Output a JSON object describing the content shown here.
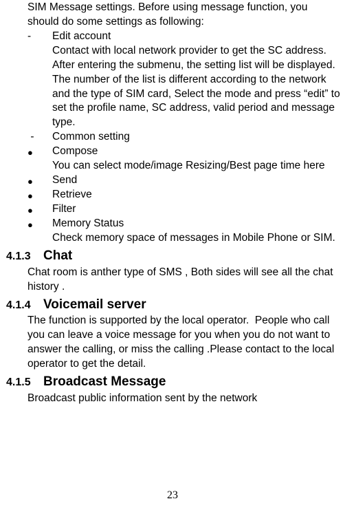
{
  "intro1": "SIM Message settings. Before using message function, you should do some settings as following:",
  "dash": "-",
  "bullet": "●",
  "editAccount": {
    "title": "Edit account",
    "desc": "Contact with local network provider to get the SC address. After entering the submenu, the setting list will be displayed. The number of the list is different according to the network and the type of SIM card, Select the mode and press “edit” to set the profile name, SC address, valid period and message type."
  },
  "commonSetting": "Common setting",
  "compose": {
    "title": "Compose",
    "desc": "You can select mode/image Resizing/Best page time here"
  },
  "send": "Send",
  "retrieve": "Retrieve",
  "filter": "Filter",
  "memoryStatus": {
    "title": "Memory Status",
    "desc": "Check memory space of messages in Mobile Phone or SIM."
  },
  "sec413": {
    "num": "4.1.3",
    "title": "Chat",
    "body": "Chat room is anther type of SMS , Both sides will see all the chat history ."
  },
  "sec414": {
    "num": "4.1.4",
    "title": "Voicemail server",
    "body": "The function is supported by the local operator.  People who call you can leave a voice message for you when you do not want to answer the calling, or miss the calling .Please contact to the local operator to get the detail."
  },
  "sec415": {
    "num": "4.1.5",
    "title": "Broadcast Message",
    "body": "Broadcast public information sent by the network"
  },
  "pageNumber": "23"
}
